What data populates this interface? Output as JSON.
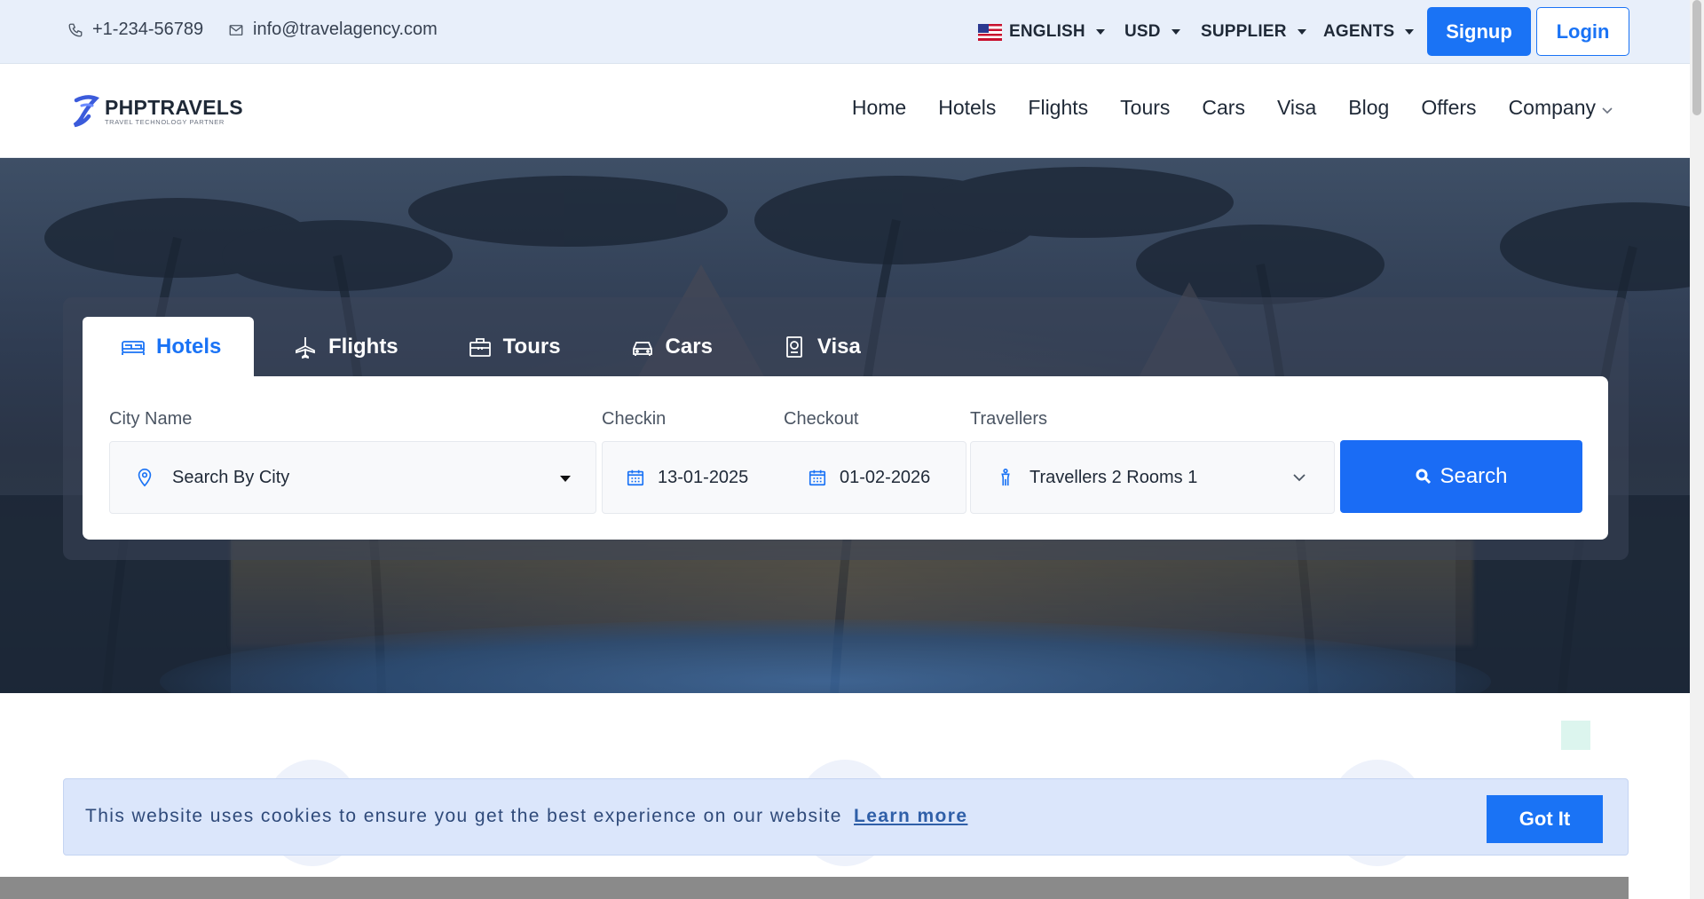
{
  "topbar": {
    "phone": "+1-234-56789",
    "email": "info@travelagency.com",
    "language": "ENGLISH",
    "currency": "USD",
    "supplier": "SUPPLIER",
    "agents": "AGENTS",
    "signup": "Signup",
    "login": "Login"
  },
  "logo": {
    "brand": "PHPTRAVELS",
    "tagline": "TRAVEL TECHNOLOGY PARTNER"
  },
  "nav": {
    "items": [
      "Home",
      "Hotels",
      "Flights",
      "Tours",
      "Cars",
      "Visa",
      "Blog",
      "Offers",
      "Company"
    ]
  },
  "search": {
    "tabs": [
      "Hotels",
      "Flights",
      "Tours",
      "Cars",
      "Visa"
    ],
    "active_tab": "Hotels",
    "city_label": "City Name",
    "city_value": "Search By City",
    "checkin_label": "Checkin",
    "checkin_value": "13-01-2025",
    "checkout_label": "Checkout",
    "checkout_value": "01-02-2026",
    "travellers_label": "Travellers",
    "travellers_value": "Travellers 2 Rooms 1",
    "search_button": "Search"
  },
  "cookie": {
    "message": "This website uses cookies to ensure you get the best experience on our website",
    "learn_more": "Learn more",
    "accept": "Got It"
  },
  "colors": {
    "accent": "#1a73f5",
    "topbar_bg": "#e8effa",
    "cookie_bg": "#dbe6fb"
  }
}
